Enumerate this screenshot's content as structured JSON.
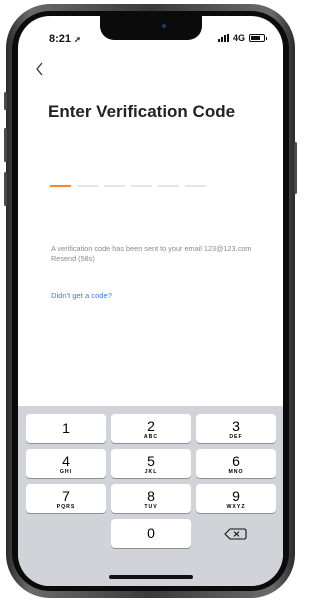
{
  "status_bar": {
    "time": "8:21",
    "network": "4G"
  },
  "screen": {
    "title": "Enter Verification Code",
    "code_length": 6,
    "message": "A verification code has been sent to your email 123@123.com",
    "resend_label": "Resend (58s)",
    "help_link": "Didn't get a code?"
  },
  "keypad": {
    "keys": [
      {
        "num": "1",
        "letters": ""
      },
      {
        "num": "2",
        "letters": "ABC"
      },
      {
        "num": "3",
        "letters": "DEF"
      },
      {
        "num": "4",
        "letters": "GHI"
      },
      {
        "num": "5",
        "letters": "JKL"
      },
      {
        "num": "6",
        "letters": "MNO"
      },
      {
        "num": "7",
        "letters": "PQRS"
      },
      {
        "num": "8",
        "letters": "TUV"
      },
      {
        "num": "9",
        "letters": "WXYZ"
      },
      {
        "num": "0",
        "letters": ""
      }
    ],
    "delete_icon": "backspace-icon"
  },
  "colors": {
    "accent": "#f08a2a",
    "link": "#3f7de0",
    "keyboard_bg": "#d2d3d8"
  }
}
